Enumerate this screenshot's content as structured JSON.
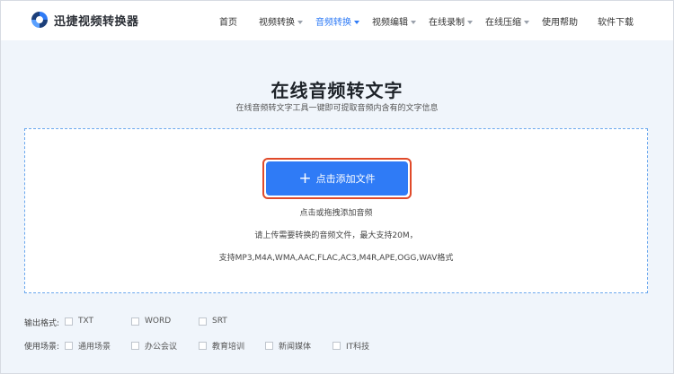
{
  "brand": {
    "name": "迅捷视频转换器",
    "icon": "logo-icon"
  },
  "nav": [
    {
      "label": "首页",
      "dropdown": false,
      "active": false
    },
    {
      "label": "视频转换",
      "dropdown": true,
      "active": false
    },
    {
      "label": "音频转换",
      "dropdown": true,
      "active": true
    },
    {
      "label": "视频编辑",
      "dropdown": true,
      "active": false
    },
    {
      "label": "在线录制",
      "dropdown": true,
      "active": false
    },
    {
      "label": "在线压缩",
      "dropdown": true,
      "active": false
    },
    {
      "label": "使用帮助",
      "dropdown": false,
      "active": false
    },
    {
      "label": "软件下载",
      "dropdown": false,
      "active": false
    }
  ],
  "hero": {
    "title": "在线音频转文字",
    "subtitle": "在线音频转文字工具一键即可提取音频内含有的文字信息"
  },
  "upload": {
    "add_button_label": "点击添加文件",
    "drag_hint": "点击或拖拽添加音频",
    "size_hint": "请上传需要转换的音频文件，最大支持20M，",
    "formats_hint": "支持MP3,M4A,WMA,AAC,FLAC,AC3,M4R,APE,OGG,WAV格式"
  },
  "output_format": {
    "label": "输出格式:",
    "options": [
      "TXT",
      "WORD",
      "SRT"
    ]
  },
  "scenario": {
    "label": "使用场景:",
    "options": [
      "通用场景",
      "办公会议",
      "教育培训",
      "新闻媒体",
      "IT科技"
    ]
  },
  "colors": {
    "accent": "#2f7bf6",
    "highlight_border": "#e04a2a",
    "background": "#f0f5fb"
  }
}
